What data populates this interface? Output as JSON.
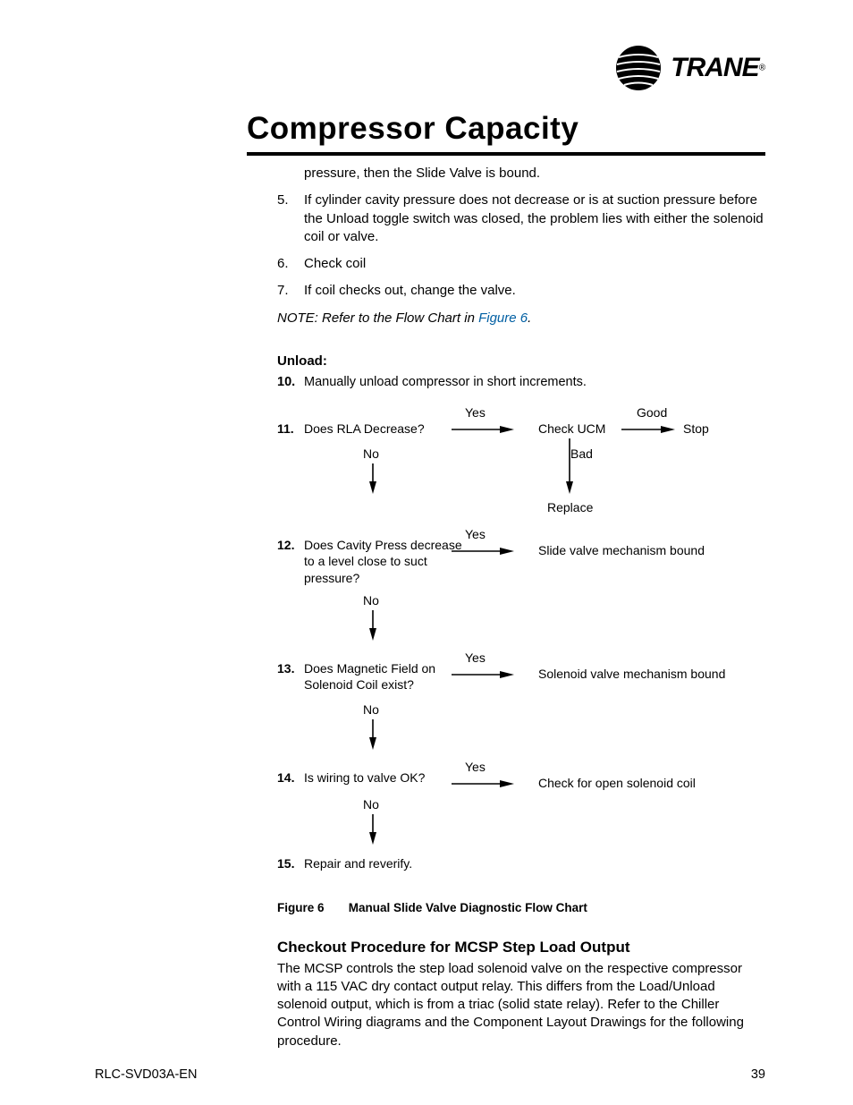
{
  "brand": {
    "name": "TRANE",
    "reg": "®"
  },
  "title": "Compressor Capacity",
  "intro_tail": "pressure, then the Slide Valve is bound.",
  "items": {
    "5": {
      "n": "5.",
      "t": "If cylinder cavity pressure does not decrease or is at suction pressure before the Unload toggle switch was closed, the problem lies with either the solenoid coil or valve."
    },
    "6": {
      "n": "6.",
      "t": "Check coil"
    },
    "7": {
      "n": "7.",
      "t": "If coil checks out, change the valve."
    }
  },
  "note": {
    "lead": "NOTE:   Refer to the Flow Chart in ",
    "link": "Figure 6",
    "tail": "."
  },
  "unload": {
    "hdr": "Unload:",
    "s10": {
      "n": "10.",
      "t": "Manually unload compressor in short increments."
    },
    "s11": {
      "n": "11.",
      "t": "Does RLA Decrease?"
    },
    "s12": {
      "n": "12.",
      "t": "Does Cavity Press decrease to a level close to suct pressure?"
    },
    "s13": {
      "n": "13.",
      "t": "Does Magnetic Field on Solenoid Coil exist?"
    },
    "s14": {
      "n": "14.",
      "t": "Is wiring to valve OK?"
    },
    "s15": {
      "n": "15.",
      "t": "Repair and reverify."
    }
  },
  "labels": {
    "yes": "Yes",
    "no": "No",
    "good": "Good",
    "bad": "Bad",
    "check_ucm": "Check UCM",
    "stop": "Stop",
    "replace": "Replace",
    "slide_bound": "Slide valve mechanism bound",
    "sol_bound": "Solenoid valve mechanism bound",
    "open_sol": "Check for open solenoid coil"
  },
  "figure": {
    "label": "Figure 6",
    "caption": "Manual Slide Valve Diagnostic Flow Chart"
  },
  "checkout": {
    "hdr": "Checkout Procedure for MCSP Step Load Output",
    "body": "The MCSP controls the step load solenoid valve on the respective compressor with a 115 VAC dry contact output relay. This differs from the Load/Unload solenoid output, which is from a triac (solid state relay). Refer to the Chiller Control Wiring diagrams and the Component Layout Drawings for the following procedure."
  },
  "footer": {
    "doc": "RLC-SVD03A-EN",
    "page": "39"
  }
}
